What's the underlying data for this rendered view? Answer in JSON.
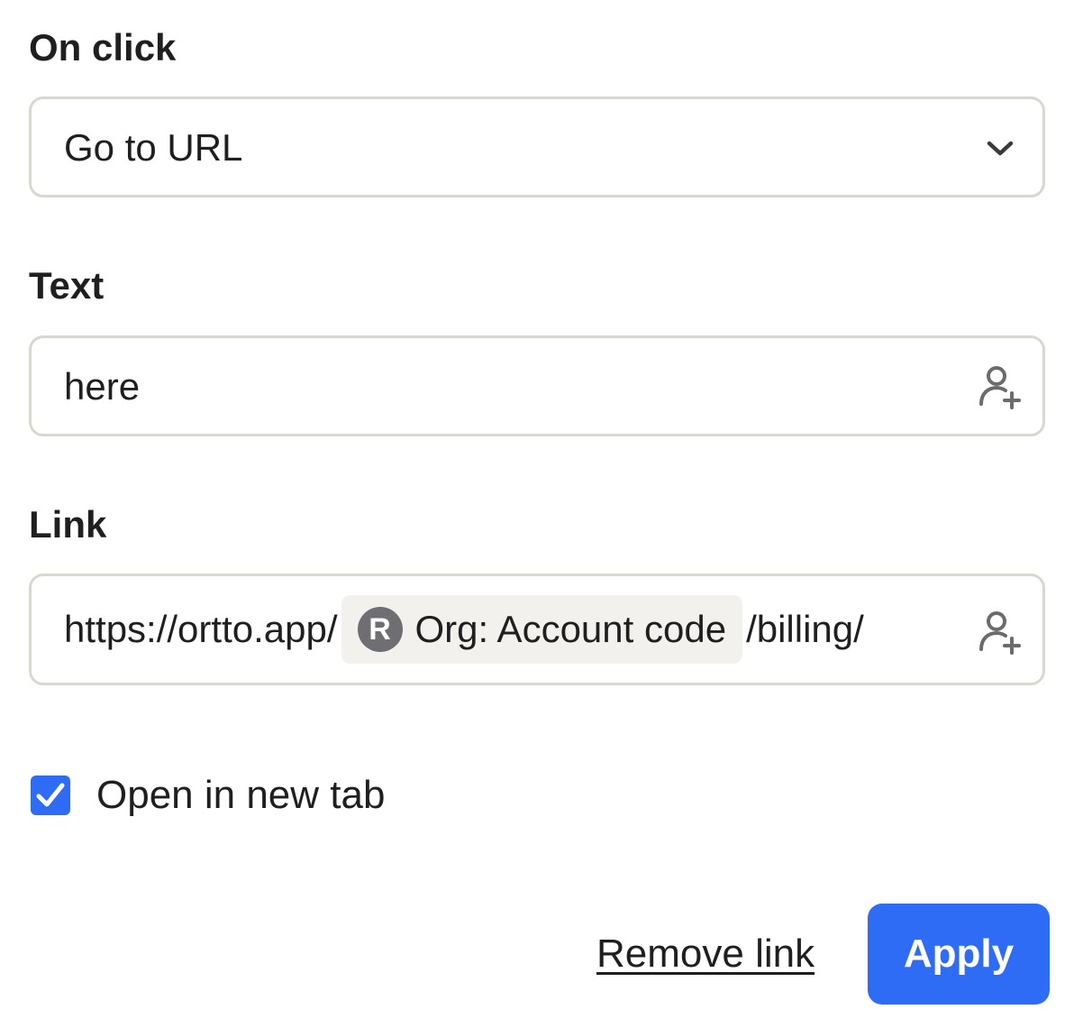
{
  "on_click": {
    "label": "On click",
    "selected": "Go to URL"
  },
  "text_field": {
    "label": "Text",
    "value": "here"
  },
  "link_field": {
    "label": "Link",
    "prefix": "https://ortto.app/",
    "chip_label": "Org: Account code",
    "suffix": "/billing/",
    "chip_badge_letter": "R"
  },
  "open_new_tab": {
    "label": "Open in new tab",
    "checked": true
  },
  "actions": {
    "remove_label": "Remove link",
    "apply_label": "Apply"
  },
  "icons": {
    "dropdown": "chevron-down-icon",
    "personalize": "user-plus-icon",
    "checkmark": "check-icon"
  },
  "colors": {
    "accent": "#2e6cf6",
    "border": "#d9d8d0",
    "chip_bg": "#f2f1ee",
    "badge": "#6e6e73",
    "text": "#1f1f1f"
  }
}
